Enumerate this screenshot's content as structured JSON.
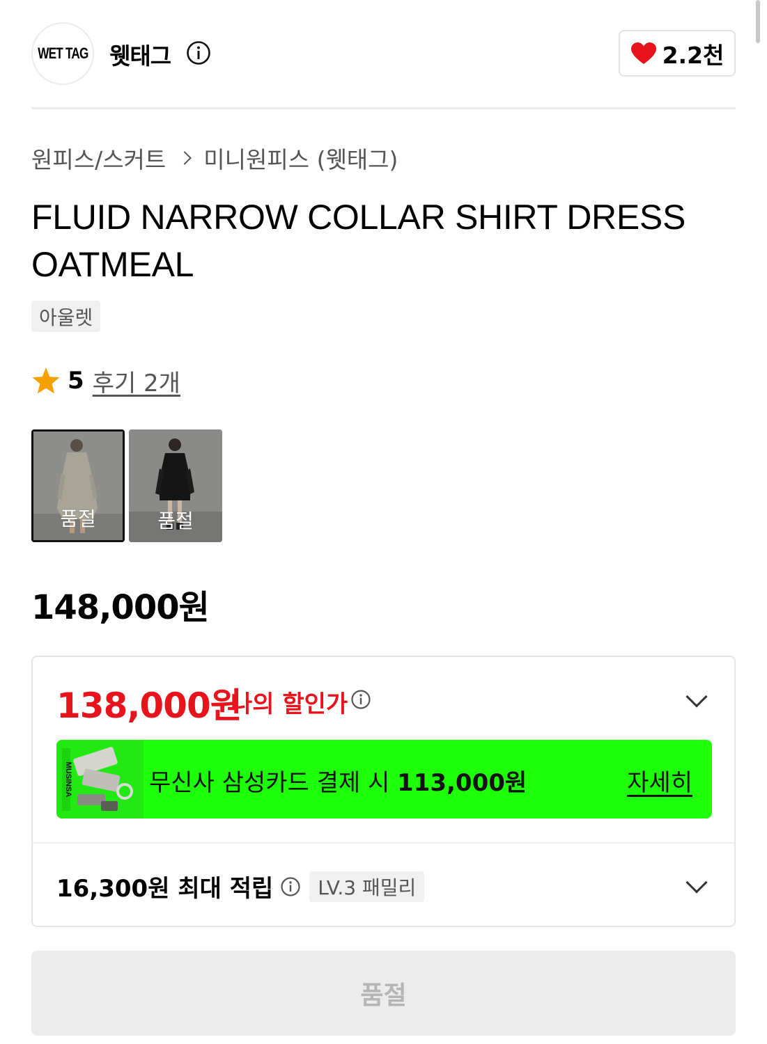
{
  "brand": {
    "logo_text": "WET TAG",
    "name": "웻태그",
    "like_count": "2.2천"
  },
  "breadcrumb": {
    "category": "원피스/스커트",
    "subcategory": "미니원피스 (웻태그)"
  },
  "product": {
    "title": "FLUID NARROW COLLAR SHIRT DRESS OATMEAL",
    "tag": "아울렛",
    "rating": "5",
    "reviews_label": "후기 2개",
    "price": "148,000원"
  },
  "color_options": [
    {
      "label": "품절",
      "color": "oatmeal",
      "selected": true
    },
    {
      "label": "품절",
      "color": "black",
      "selected": false
    }
  ],
  "discount": {
    "price": "138,000원",
    "label": "나의 할인가",
    "card_banner": {
      "text_prefix": "무신사 삼성카드 결제 시",
      "amount": "113,000원",
      "detail_link": "자세히",
      "card_brand": "MUSINSA"
    },
    "points": {
      "text": "16,300원 최대 적립",
      "level": "LV.3 패밀리"
    }
  },
  "cta": {
    "label": "품절"
  },
  "colors": {
    "discount_red": "#e8141d",
    "banner_green": "#1eff0a",
    "heart_red": "#e8141d"
  }
}
